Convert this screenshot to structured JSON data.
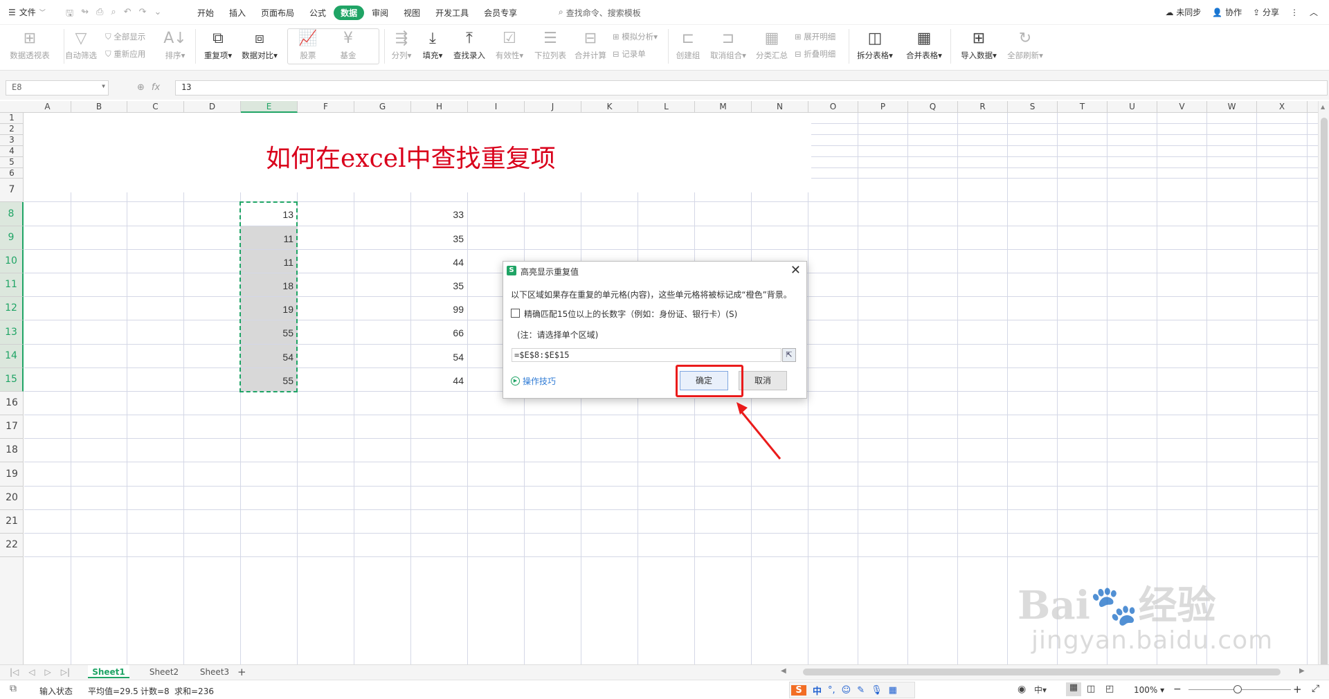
{
  "menubar": {
    "file_label": "文件",
    "menus": [
      {
        "label": "开始",
        "active": false
      },
      {
        "label": "插入",
        "active": false
      },
      {
        "label": "页面布局",
        "active": false
      },
      {
        "label": "公式",
        "active": false
      },
      {
        "label": "数据",
        "active": true
      },
      {
        "label": "审阅",
        "active": false
      },
      {
        "label": "视图",
        "active": false
      },
      {
        "label": "开发工具",
        "active": false
      },
      {
        "label": "会员专享",
        "active": false
      }
    ],
    "search_placeholder": "查找命令、搜索模板",
    "sync_label": "未同步",
    "collab_label": "协作",
    "share_label": "分享"
  },
  "ribbon": {
    "pivot": "数据透视表",
    "autofilter": "自动筛选",
    "show_all": "全部显示",
    "reapply": "重新应用",
    "sort": "排序",
    "duplicates": "重复项",
    "compare": "数据对比",
    "stock": "股票",
    "fund": "基金",
    "split_col": "分列",
    "fill": "填充",
    "lookup_entry": "查找录入",
    "validity": "有效性",
    "dropdown": "下拉列表",
    "consolidate": "合并计算",
    "what_if": "模拟分析",
    "record": "记录单",
    "group": "创建组",
    "ungroup": "取消组合",
    "subtotal": "分类汇总",
    "expand": "展开明细",
    "collapse": "折叠明细",
    "split_table": "拆分表格",
    "merge_table": "合并表格",
    "import": "导入数据",
    "refresh_all": "全部刷新"
  },
  "formula_bar": {
    "name_box": "E8",
    "formula": "13"
  },
  "sheet": {
    "columns": [
      "A",
      "B",
      "C",
      "D",
      "E",
      "F",
      "G",
      "H",
      "I",
      "J",
      "K",
      "L",
      "M",
      "N",
      "O",
      "P",
      "Q",
      "R",
      "S",
      "T",
      "U",
      "V",
      "W",
      "X"
    ],
    "rows": [
      "1",
      "2",
      "3",
      "4",
      "5",
      "6",
      "7",
      "8",
      "9",
      "10",
      "11",
      "12",
      "13",
      "14",
      "15",
      "16",
      "17",
      "18",
      "19",
      "20",
      "21",
      "22"
    ],
    "selected_column": "E",
    "title": "如何在excel中查找重复项",
    "column_e": [
      "13",
      "11",
      "11",
      "18",
      "19",
      "55",
      "54",
      "55"
    ],
    "column_h": [
      "33",
      "35",
      "44",
      "35",
      "99",
      "66",
      "54",
      "44"
    ]
  },
  "tabs": [
    "Sheet1",
    "Sheet2",
    "Sheet3"
  ],
  "active_tab": "Sheet1",
  "status": {
    "mode": "输入状态",
    "average": "平均值=29.5",
    "count": "计数=8",
    "sum": "求和=236",
    "zoom": "100%"
  },
  "dialog": {
    "title": "高亮显示重复值",
    "message": "以下区域如果存在重复的单元格(内容)，这些单元格将被标记成“橙色”背景。",
    "checkbox_label": "精确匹配15位以上的长数字（例如：身份证、银行卡）(S)",
    "note": "(注：请选择单个区域)",
    "range": "=$E$8:$E$15",
    "tips": "操作技巧",
    "ok": "确定",
    "cancel": "取消"
  },
  "watermark": {
    "brand": "Bai",
    "brand_tail": "经验",
    "url": "jingyan.baidu.com"
  },
  "colors": {
    "accent": "#1fa465",
    "title_red": "#d9001b",
    "highlight_red": "#ea1b1b"
  }
}
